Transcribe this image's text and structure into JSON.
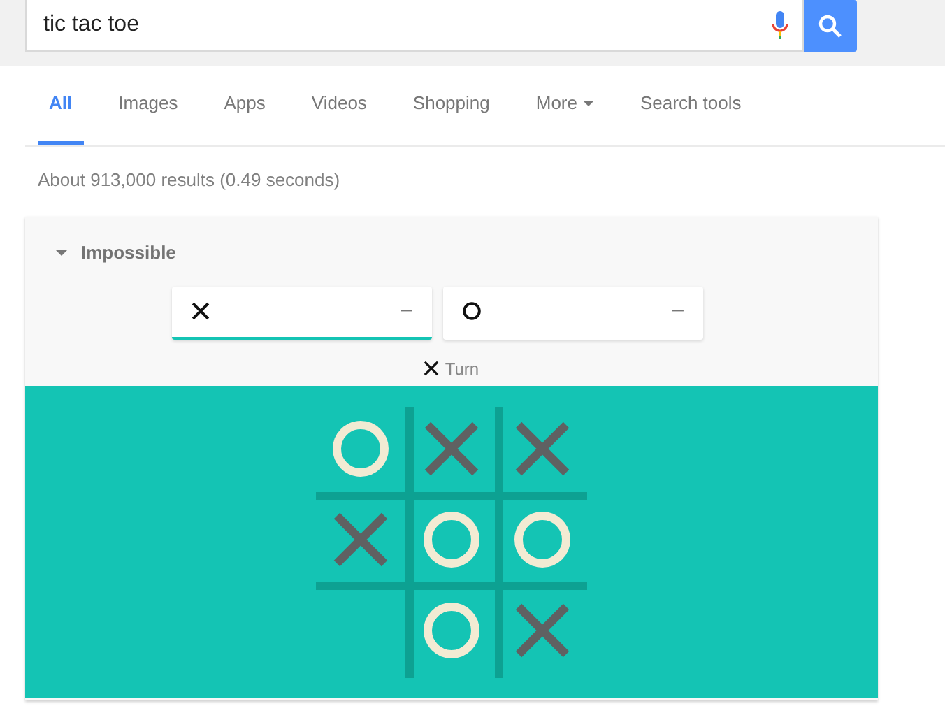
{
  "search": {
    "value": "tic tac toe"
  },
  "tabs": [
    {
      "label": "All",
      "selected": true,
      "kind": "plain"
    },
    {
      "label": "Images",
      "selected": false,
      "kind": "plain"
    },
    {
      "label": "Apps",
      "selected": false,
      "kind": "plain"
    },
    {
      "label": "Videos",
      "selected": false,
      "kind": "plain"
    },
    {
      "label": "Shopping",
      "selected": false,
      "kind": "plain"
    },
    {
      "label": "More",
      "selected": false,
      "kind": "menu"
    },
    {
      "label": "Search tools",
      "selected": false,
      "kind": "plain"
    }
  ],
  "result_stats": "About 913,000 results (0.49 seconds)",
  "game": {
    "difficulty": "Impossible",
    "expanded": true,
    "players": [
      {
        "kind": "x",
        "score": "–",
        "selected": true
      },
      {
        "kind": "o",
        "score": "–",
        "selected": false
      }
    ],
    "turn": {
      "kind": "x",
      "label": "Turn"
    },
    "board": [
      {
        "kind": "o"
      },
      {
        "kind": "x"
      },
      {
        "kind": "x"
      },
      {
        "kind": "x"
      },
      {
        "kind": "o"
      },
      {
        "kind": "o"
      },
      {
        "kind": "empty"
      },
      {
        "kind": "o"
      },
      {
        "kind": "x"
      }
    ]
  }
}
